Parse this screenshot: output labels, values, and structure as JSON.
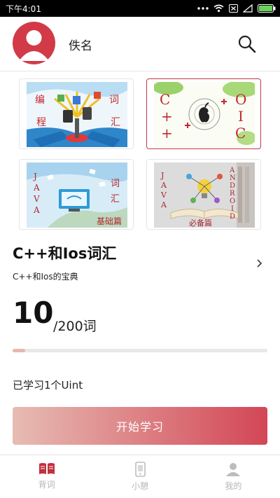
{
  "status_bar": {
    "time": "下午4:01"
  },
  "header": {
    "username": "佚名"
  },
  "book": {
    "title": "C++和Ios词汇",
    "subtitle": "C++和Ios的宝典",
    "words_learned": "10",
    "words_total": "/200词",
    "progress_fraction": 0.05,
    "learned_units": "已学习1个Uint"
  },
  "thumbnails": {
    "vocab_cover": {
      "chars_left": [
        "编",
        "程"
      ],
      "chars_right": [
        "词",
        "汇"
      ]
    },
    "cpp_ios_cover": {
      "left_text": [
        "C",
        "+",
        "+"
      ],
      "right_text": [
        "O",
        "I",
        "C"
      ]
    },
    "java_basics_cover": {
      "left_text": [
        "J",
        "A",
        "V",
        "A"
      ],
      "right_text": [
        "词",
        "汇"
      ],
      "bottom_text": "基础篇"
    },
    "java_android_cover": {
      "left_text": [
        "J",
        "A",
        "V",
        "A"
      ],
      "right_text": [
        "A",
        "N",
        "D",
        "R",
        "O",
        "I",
        "D"
      ],
      "bottom_text": "必备篇"
    }
  },
  "primary_action": {
    "label": "开始学习"
  },
  "tabs": [
    {
      "label": "背词",
      "icon": "book-icon",
      "active": true
    },
    {
      "label": "小憩",
      "icon": "phone-icon",
      "active": false
    },
    {
      "label": "我的",
      "icon": "person-icon",
      "active": false
    }
  ],
  "colors": {
    "accent": "#c1303f",
    "avatar": "#d23a48",
    "button_start": "#e7bcb3",
    "button_end": "#d34656"
  }
}
